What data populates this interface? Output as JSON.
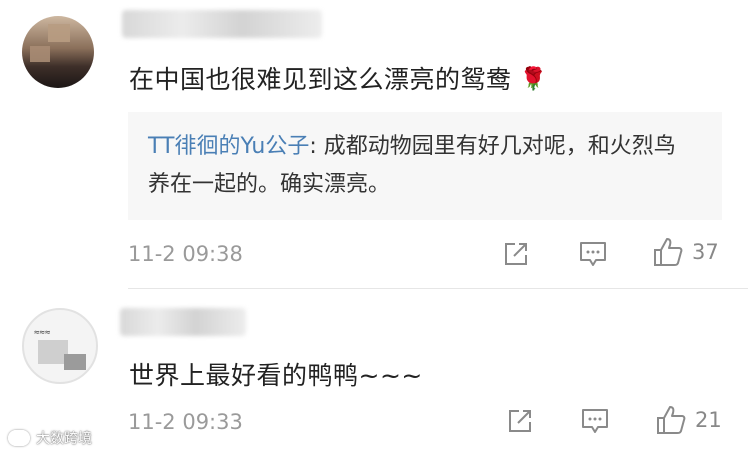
{
  "comments": [
    {
      "text": "在中国也很难见到这么漂亮的鸳鸯",
      "emoji": "🌹",
      "reply": {
        "author": "TT徘徊的Yu公子",
        "separator": ": ",
        "text": "成都动物园里有好几对呢，和火烈鸟养在一起的。确实漂亮。"
      },
      "timestamp": "11-2 09:38",
      "like_count": "37"
    },
    {
      "text": "世界上最好看的鸭鸭~~~",
      "timestamp": "11-2 09:33",
      "like_count": "21"
    }
  ],
  "watermark": {
    "text": "大数跨境"
  },
  "icons": [
    "share-icon",
    "comment-icon",
    "like-icon",
    "rose-icon"
  ],
  "colors": {
    "link": "#4a7fb5",
    "muted": "#9a9a9a",
    "reply_bg": "#f7f7f7"
  }
}
